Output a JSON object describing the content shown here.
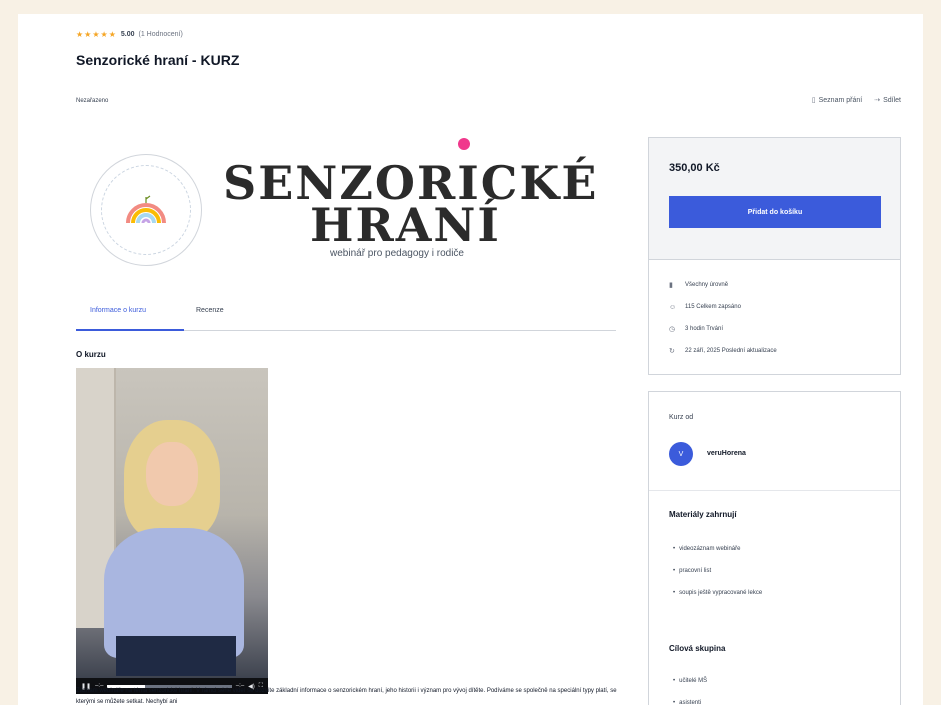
{
  "rating": {
    "stars": "★★★★★",
    "score": "5.00",
    "count": "(1 Hodnocení)",
    "value": 5
  },
  "course": {
    "title": "Senzorické hraní - KURZ",
    "category": "Nezařazeno"
  },
  "actions": {
    "wishlist": "Seznam přání",
    "share": "Sdílet"
  },
  "banner": {
    "line1": "SENZORICKÉ",
    "line2": "HRANÍ",
    "subtitle": "webinář pro pedagogy i rodiče"
  },
  "tabs": [
    {
      "label": "Informace o kurzu",
      "active": true
    },
    {
      "label": "Recenze",
      "active": false
    }
  ],
  "about": {
    "heading": "O kurzu",
    "description": "Záznam webináře na téma senzorické hraní. V rámci série videí se dozvíte základní informace o senzorickém hraní, jeho historii i význam pro vývoj dítěte. Podíváme se společně na speciální typy platí, se kterými se můžete setkat. Nechybí ani"
  },
  "pricing": {
    "price": "350,00 Kč",
    "add_to_cart": "Přidat do košíku"
  },
  "meta": [
    {
      "icon": "level-icon",
      "glyph": "▮",
      "text": "Všechny úrovně"
    },
    {
      "icon": "students-icon",
      "glyph": "☺",
      "text": "115 Celkem zapsáno"
    },
    {
      "icon": "clock-icon",
      "glyph": "◷",
      "text": "3 hodin Trvání"
    },
    {
      "icon": "update-icon",
      "glyph": "↻",
      "text": "22 září, 2025 Poslední aktualizace"
    }
  ],
  "instructor": {
    "label": "Kurz od",
    "avatar_letter": "V",
    "name": "veruHorena"
  },
  "materials": {
    "heading": "Materiály zahrnují",
    "items": [
      "videozáznam webináře",
      "pracovní list",
      "soupis ještě vypracované lekce"
    ]
  },
  "target": {
    "heading": "Cílová skupina",
    "items": [
      "učitelé MŠ",
      "asistenti"
    ]
  },
  "video": {
    "progress": 0.3
  },
  "colors": {
    "accent": "#3b5bdb",
    "star": "#f5a524",
    "pink": "#f0388c",
    "page_bg": "#f8f1e5"
  }
}
